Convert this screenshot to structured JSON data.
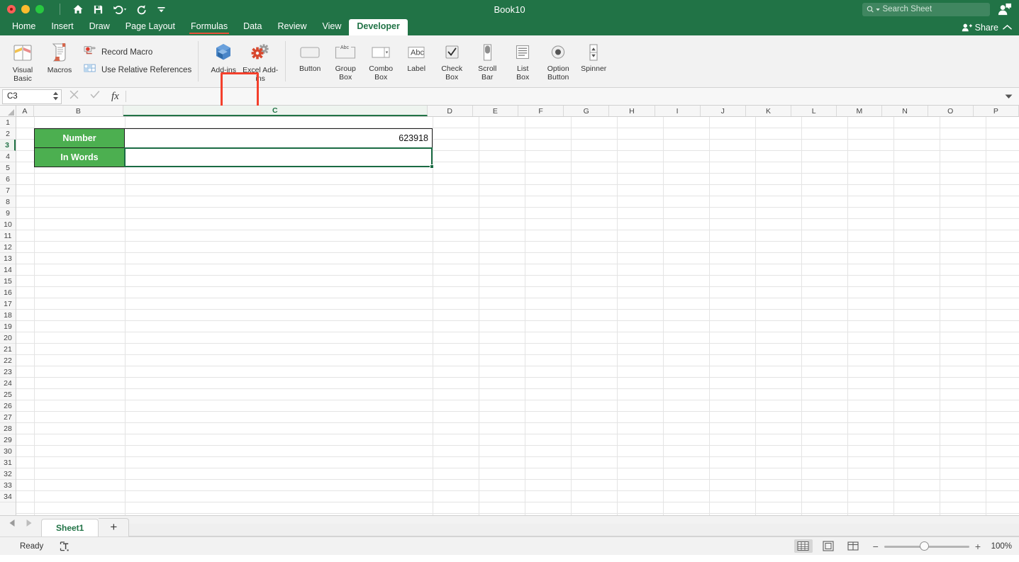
{
  "titlebar": {
    "app_title": "Book10",
    "quick_access": [
      {
        "name": "home-icon",
        "label": "Home"
      },
      {
        "name": "save-icon",
        "label": "Save"
      },
      {
        "name": "undo-icon",
        "label": "Undo"
      },
      {
        "name": "redo-icon",
        "label": "Redo"
      },
      {
        "name": "customize-toolbar-icon",
        "label": "Customize Toolbar"
      }
    ],
    "search_placeholder": "Search Sheet",
    "search_value": "",
    "account_icon": "account-icon"
  },
  "tabs": {
    "items": [
      {
        "label": "Home",
        "active": false
      },
      {
        "label": "Insert",
        "active": false
      },
      {
        "label": "Draw",
        "active": false
      },
      {
        "label": "Page Layout",
        "active": false
      },
      {
        "label": "Formulas",
        "active": false
      },
      {
        "label": "Data",
        "active": false
      },
      {
        "label": "Review",
        "active": false
      },
      {
        "label": "View",
        "active": false
      },
      {
        "label": "Developer",
        "active": true
      }
    ],
    "share_label": "Share",
    "collapse_icon": "chevron-up-icon"
  },
  "ribbon": {
    "code_group": {
      "visual_basic": "Visual Basic",
      "macros": "Macros",
      "record_macro": "Record Macro",
      "use_relative_references": "Use Relative References"
    },
    "addins_group": {
      "addins": "Add-ins",
      "excel_addins": "Excel Add-ins",
      "highlighted": "Excel Add-ins",
      "highlight_color": "#f4402c"
    },
    "controls_group": [
      {
        "label_line1": "Button",
        "label_line2": "",
        "icon": "button-control-icon"
      },
      {
        "label_line1": "Group",
        "label_line2": "Box",
        "icon": "group-box-control-icon"
      },
      {
        "label_line1": "Combo",
        "label_line2": "Box",
        "icon": "combo-box-control-icon"
      },
      {
        "label_line1": "Label",
        "label_line2": "",
        "icon": "label-control-icon"
      },
      {
        "label_line1": "Check",
        "label_line2": "Box",
        "icon": "check-box-control-icon"
      },
      {
        "label_line1": "Scroll",
        "label_line2": "Bar",
        "icon": "scroll-bar-control-icon"
      },
      {
        "label_line1": "List",
        "label_line2": "Box",
        "icon": "list-box-control-icon"
      },
      {
        "label_line1": "Option",
        "label_line2": "Button",
        "icon": "option-button-control-icon"
      },
      {
        "label_line1": "Spinner",
        "label_line2": "",
        "icon": "spinner-control-icon"
      }
    ]
  },
  "formula_bar": {
    "name_box_value": "C3",
    "cancel_icon": "cancel-icon",
    "confirm_icon": "confirm-icon",
    "function_icon": "fx",
    "formula_value": ""
  },
  "grid": {
    "columns": [
      "A",
      "B",
      "C",
      "D",
      "E",
      "F",
      "G",
      "H",
      "I",
      "J",
      "K",
      "L",
      "M",
      "N",
      "O",
      "P"
    ],
    "selected_column": "C",
    "rows": [
      1,
      2,
      3,
      4,
      5,
      6,
      7,
      8,
      9,
      10,
      11,
      12,
      13,
      14,
      15,
      16,
      17,
      18,
      19,
      20,
      21,
      22,
      23,
      24,
      25,
      26,
      27,
      28,
      29,
      30,
      31,
      32,
      33,
      34
    ],
    "selected_row": 3,
    "active_cell": "C3",
    "cells": [
      {
        "ref": "B2",
        "value": "Number",
        "style": "green-header"
      },
      {
        "ref": "C2",
        "value": "623918",
        "style": "number"
      },
      {
        "ref": "B3",
        "value": "In Words",
        "style": "green-header"
      },
      {
        "ref": "C3",
        "value": "",
        "style": "empty-selected"
      }
    ],
    "header_fill_color": "#4caf50",
    "selection_border_color": "#1a6b43"
  },
  "sheetbar": {
    "prev_icon": "prev-sheet-icon",
    "next_icon": "next-sheet-icon",
    "sheets": [
      {
        "name": "Sheet1",
        "active": true
      }
    ],
    "add_sheet_label": "+"
  },
  "statusbar": {
    "status_text": "Ready",
    "accessibility_icon": "accessibility-icon",
    "view_buttons": [
      {
        "name": "normal-view-button",
        "active": true
      },
      {
        "name": "page-layout-view-button",
        "active": false
      },
      {
        "name": "page-break-view-button",
        "active": false
      }
    ],
    "zoom_out_label": "−",
    "zoom_in_label": "+",
    "zoom_level": "100%"
  }
}
